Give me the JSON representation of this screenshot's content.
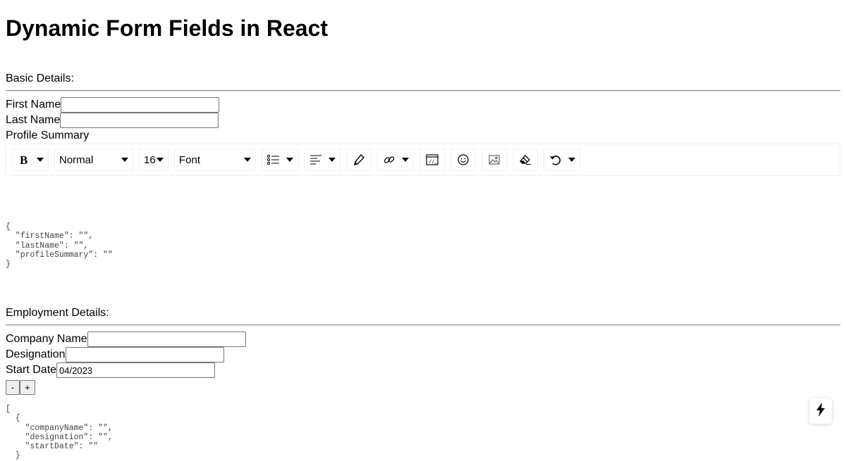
{
  "page": {
    "title": "Dynamic Form Fields in React"
  },
  "basic": {
    "heading": "Basic Details:",
    "first_name_label": "First Name",
    "first_name_value": "",
    "last_name_label": "Last Name",
    "last_name_value": "",
    "profile_summary_label": "Profile Summary",
    "json_preview": "{\n  \"firstName\": \"\",\n  \"lastName\": \"\",\n  \"profileSummary\": \"\"\n}"
  },
  "toolbar": {
    "block_type": "Normal",
    "font_size": "16",
    "font_family": "Font",
    "icons": [
      "bold-icon",
      "list-icon",
      "align-left-icon",
      "color-picker-icon",
      "link-icon",
      "embed-icon",
      "emoji-icon",
      "image-icon",
      "eraser-icon",
      "undo-icon"
    ]
  },
  "employment": {
    "heading": "Employment Details:",
    "company_label": "Company Name",
    "company_value": "",
    "designation_label": "Designation",
    "designation_value": "",
    "start_date_label": "Start Date",
    "start_date_value": "04/2023",
    "remove_label": "-",
    "add_label": "+",
    "json_preview": "[\n  {\n    \"companyName\": \"\",\n    \"designation\": \"\",\n    \"startDate\": \"\"\n  }"
  }
}
